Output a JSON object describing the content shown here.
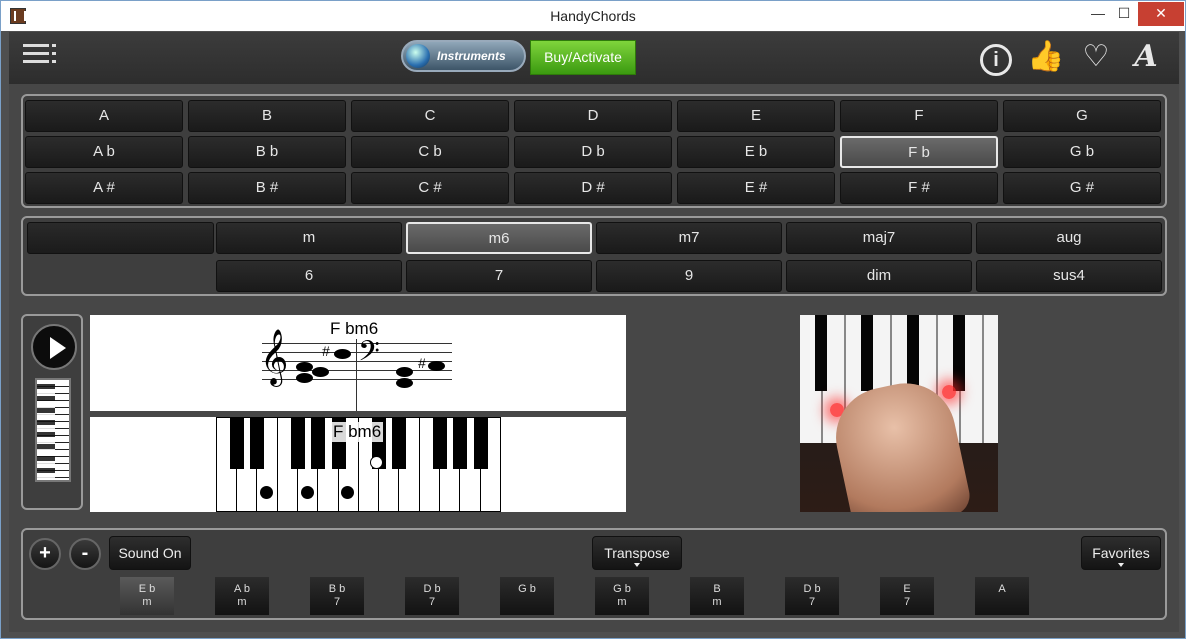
{
  "window": {
    "title": "HandyChords",
    "min_glyph": "—",
    "max_glyph": "☐",
    "close_glyph": "✕"
  },
  "toolbar": {
    "instruments_label": "Instruments",
    "buy_label": "Buy/Activate",
    "icons": [
      "menu-icon",
      "info-icon",
      "thumbs-up-icon",
      "heart-icon",
      "font-icon"
    ],
    "info_glyph": "i",
    "like_glyph": "👍",
    "heart_glyph": "♡",
    "font_glyph": "A"
  },
  "roots": {
    "rows": [
      [
        "A",
        "B",
        "C",
        "D",
        "E",
        "F",
        "G"
      ],
      [
        "A b",
        "B b",
        "C b",
        "D b",
        "E b",
        "F b",
        "G b"
      ],
      [
        "A #",
        "B #",
        "C #",
        "D #",
        "E #",
        "F #",
        "G #"
      ]
    ],
    "selected": "F b"
  },
  "qualities": {
    "row1": [
      "m",
      "m6",
      "m7",
      "maj7",
      "aug"
    ],
    "row2": [
      "6",
      "7",
      "9",
      "dim",
      "sus4"
    ],
    "selected": "m6"
  },
  "display": {
    "staff_label": "F bm6",
    "piano_label": "F bm6"
  },
  "bottom": {
    "plus": "+",
    "minus": "-",
    "sound_label": "Sound On",
    "transpose_label": "Transpose",
    "favorites_label": "Favorites",
    "chords": [
      {
        "root": "E b",
        "qual": "m"
      },
      {
        "root": "A b",
        "qual": "m"
      },
      {
        "root": "B b",
        "qual": "7"
      },
      {
        "root": "D b",
        "qual": "7"
      },
      {
        "root": "G b",
        "qual": ""
      },
      {
        "root": "G b",
        "qual": "m"
      },
      {
        "root": "B",
        "qual": "m"
      },
      {
        "root": "D b",
        "qual": "7"
      },
      {
        "root": "E",
        "qual": "7"
      },
      {
        "root": "A",
        "qual": ""
      }
    ]
  },
  "colors": {
    "accent_green": "#4caf1a",
    "close_red": "#c74032",
    "panel": "#3e3e3e"
  }
}
